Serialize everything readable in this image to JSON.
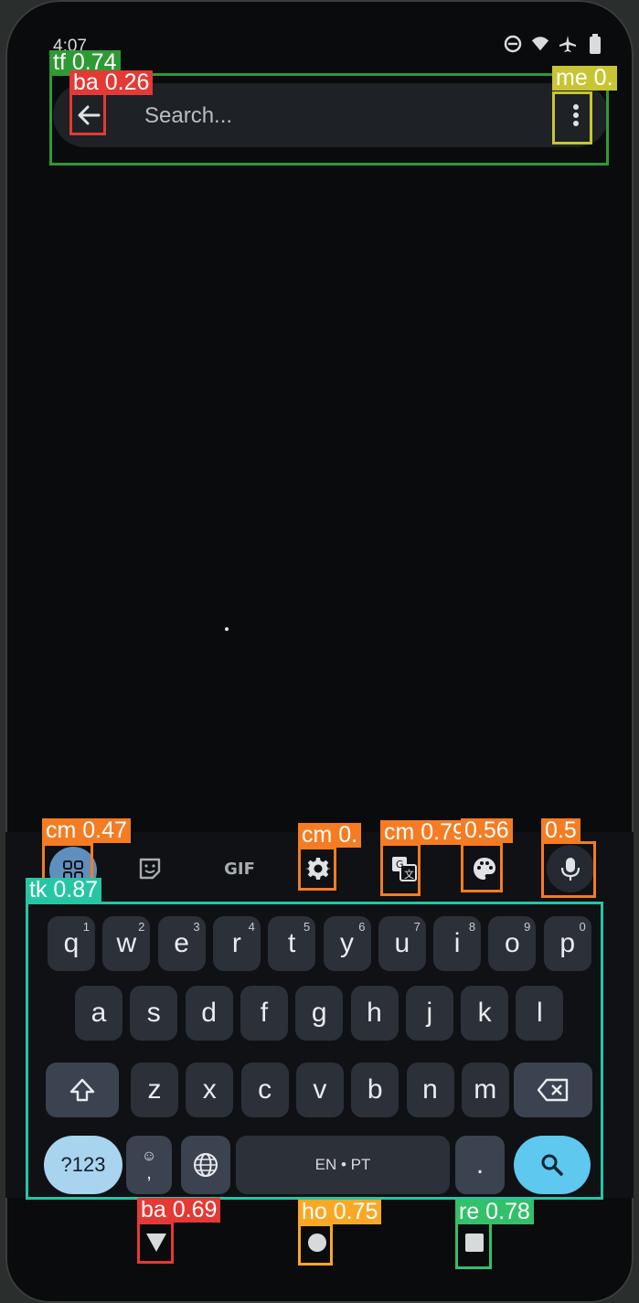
{
  "status_bar": {
    "time": "4:07",
    "icons": [
      "do-not-disturb-icon",
      "wifi-icon",
      "airplane-icon",
      "battery-icon"
    ]
  },
  "search_bar": {
    "placeholder": "Search..."
  },
  "annotations": [
    {
      "label": "tf 0.74",
      "color": "#2e9a34"
    },
    {
      "label": "ba 0.26",
      "color": "#e53935"
    },
    {
      "label": "me 0.",
      "color": "#c8c434"
    },
    {
      "label": "cm 0.47",
      "color": "#f57c22"
    },
    {
      "label": "cm 0.",
      "color": "#f57c22"
    },
    {
      "label": "cm 0.79",
      "color": "#f57c22"
    },
    {
      "label": "0.56",
      "color": "#f57c22"
    },
    {
      "label": "0.5",
      "color": "#f57c22"
    },
    {
      "label": "tk 0.87",
      "color": "#26c6a4"
    },
    {
      "label": "ba 0.69",
      "color": "#e53935"
    },
    {
      "label": "ho 0.75",
      "color": "#f9a825"
    },
    {
      "label": "re 0.78",
      "color": "#33c06a"
    }
  ],
  "keyboard": {
    "toolbar": {
      "gif": "GIF",
      "icons": [
        "apps-grid-icon",
        "sticker-icon",
        "settings-icon",
        "translate-icon",
        "palette-icon",
        "microphone-icon"
      ]
    },
    "row1": [
      {
        "k": "q",
        "h": "1"
      },
      {
        "k": "w",
        "h": "2"
      },
      {
        "k": "e",
        "h": "3"
      },
      {
        "k": "r",
        "h": "4"
      },
      {
        "k": "t",
        "h": "5"
      },
      {
        "k": "y",
        "h": "6"
      },
      {
        "k": "u",
        "h": "7"
      },
      {
        "k": "i",
        "h": "8"
      },
      {
        "k": "o",
        "h": "9"
      },
      {
        "k": "p",
        "h": "0"
      }
    ],
    "row2": [
      "a",
      "s",
      "d",
      "f",
      "g",
      "h",
      "j",
      "k",
      "l"
    ],
    "row3": [
      "z",
      "x",
      "c",
      "v",
      "b",
      "n",
      "m"
    ],
    "symbols_key": "?123",
    "comma_key": ",",
    "space_key": "EN • PT",
    "period_key": ".",
    "colors": {
      "accent": "#5ec8ef",
      "fn_key": "#a9d4f0"
    }
  },
  "nav_bar": {
    "icons": [
      "back-triangle-icon",
      "home-circle-icon",
      "recents-square-icon"
    ]
  }
}
